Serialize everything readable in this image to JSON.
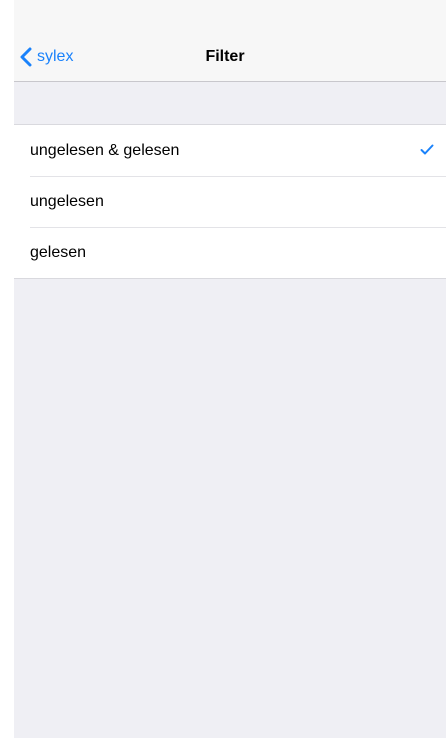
{
  "nav": {
    "back_label": "sylex",
    "back_icon": "chevron-left-icon",
    "title": "Filter"
  },
  "filters": [
    {
      "label": "ungelesen & gelesen",
      "selected": true
    },
    {
      "label": "ungelesen",
      "selected": false
    },
    {
      "label": "gelesen",
      "selected": false
    }
  ],
  "colors": {
    "accent": "#1a82fb",
    "background": "#efeff4",
    "navbar": "#f7f7f7"
  },
  "icons": {
    "checkmark": "checkmark-icon"
  }
}
